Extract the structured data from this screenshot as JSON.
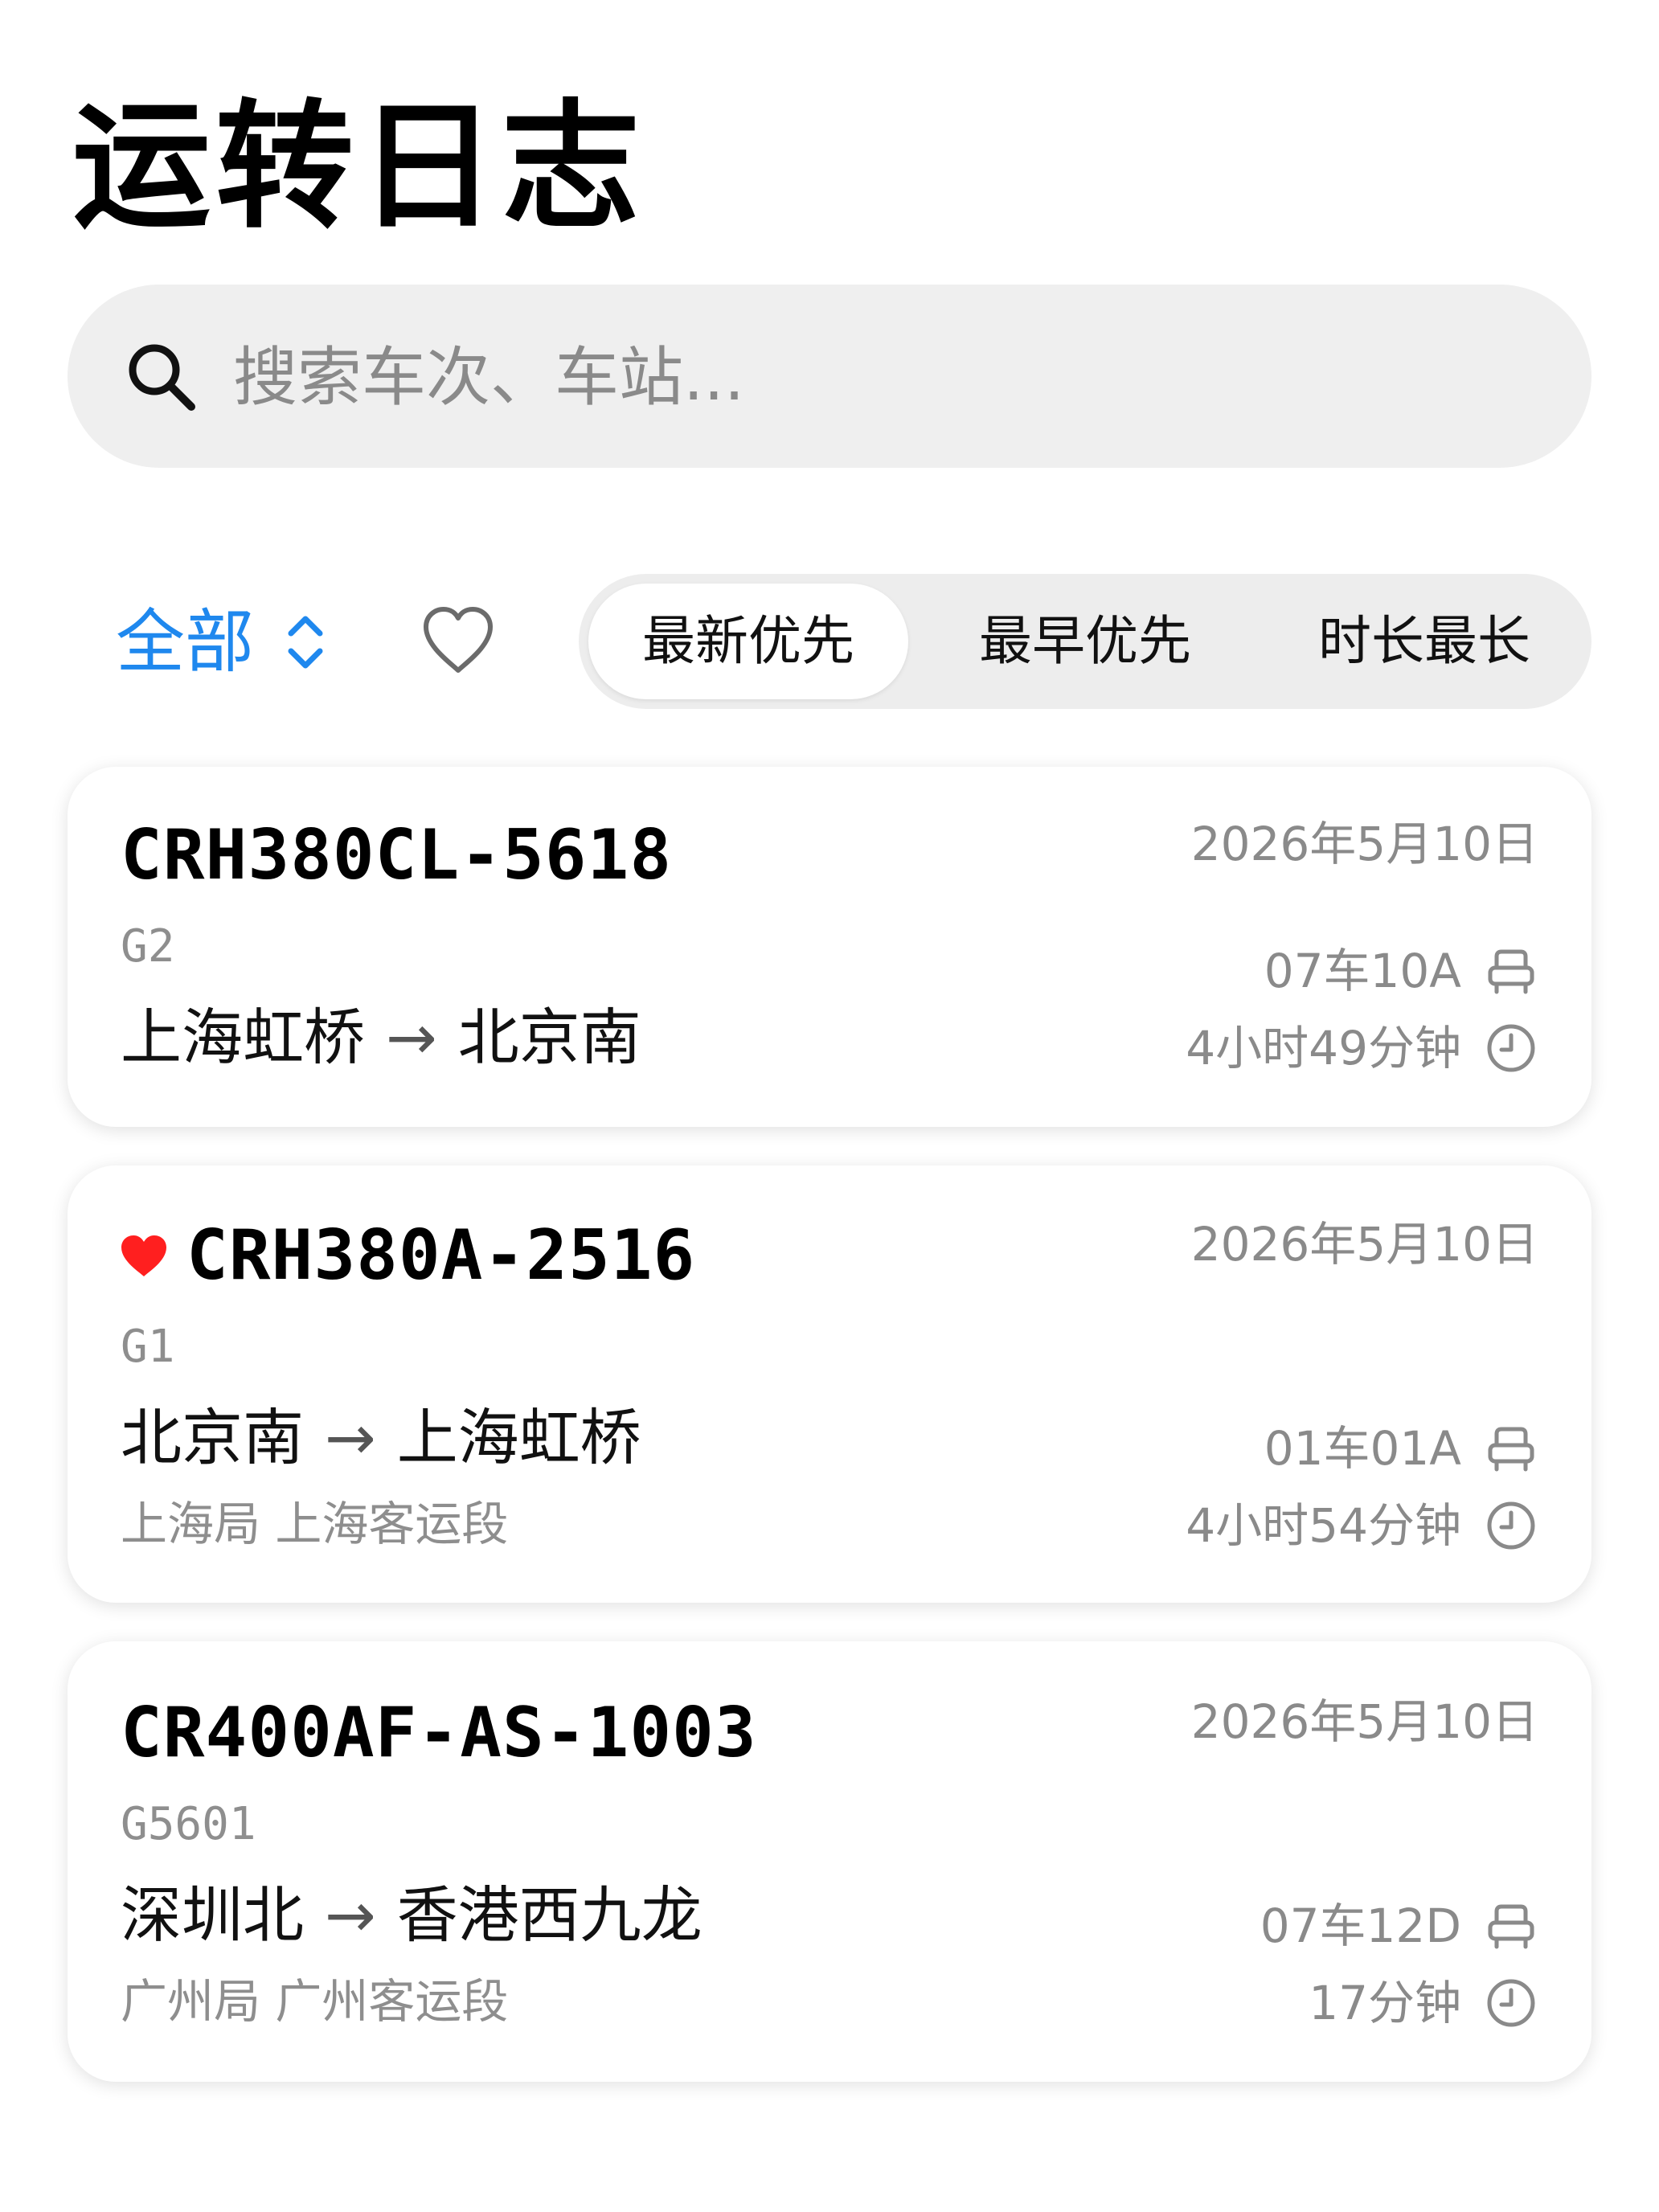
{
  "header": {
    "title": "运转日志"
  },
  "search": {
    "placeholder": "搜索车次、车站..."
  },
  "filter": {
    "all_label": "全部"
  },
  "sort_tabs": [
    {
      "label": "最新优先",
      "selected": true
    },
    {
      "label": "最早优先",
      "selected": false
    },
    {
      "label": "时长最长",
      "selected": false
    }
  ],
  "colors": {
    "accent": "#1f88ee",
    "favorite": "#ff1f1f",
    "secondary_text": "#8a8a8a"
  },
  "records": [
    {
      "favorite": false,
      "model": "CRH380CL-5618",
      "train_number": "G2",
      "from": "上海虹桥",
      "arrow": "→",
      "to": "北京南",
      "bureau": "",
      "date": "2026年5月10日",
      "seat": "07车10A",
      "duration": "4小时49分钟"
    },
    {
      "favorite": true,
      "model": "CRH380A-2516",
      "train_number": "G1",
      "from": "北京南",
      "arrow": "→",
      "to": "上海虹桥",
      "bureau": "上海局 上海客运段",
      "date": "2026年5月10日",
      "seat": "01车01A",
      "duration": "4小时54分钟"
    },
    {
      "favorite": false,
      "model": "CR400AF-AS-1003",
      "train_number": "G5601",
      "from": "深圳北",
      "arrow": "→",
      "to": "香港西九龙",
      "bureau": "广州局 广州客运段",
      "date": "2026年5月10日",
      "seat": "07车12D",
      "duration": "17分钟"
    }
  ]
}
